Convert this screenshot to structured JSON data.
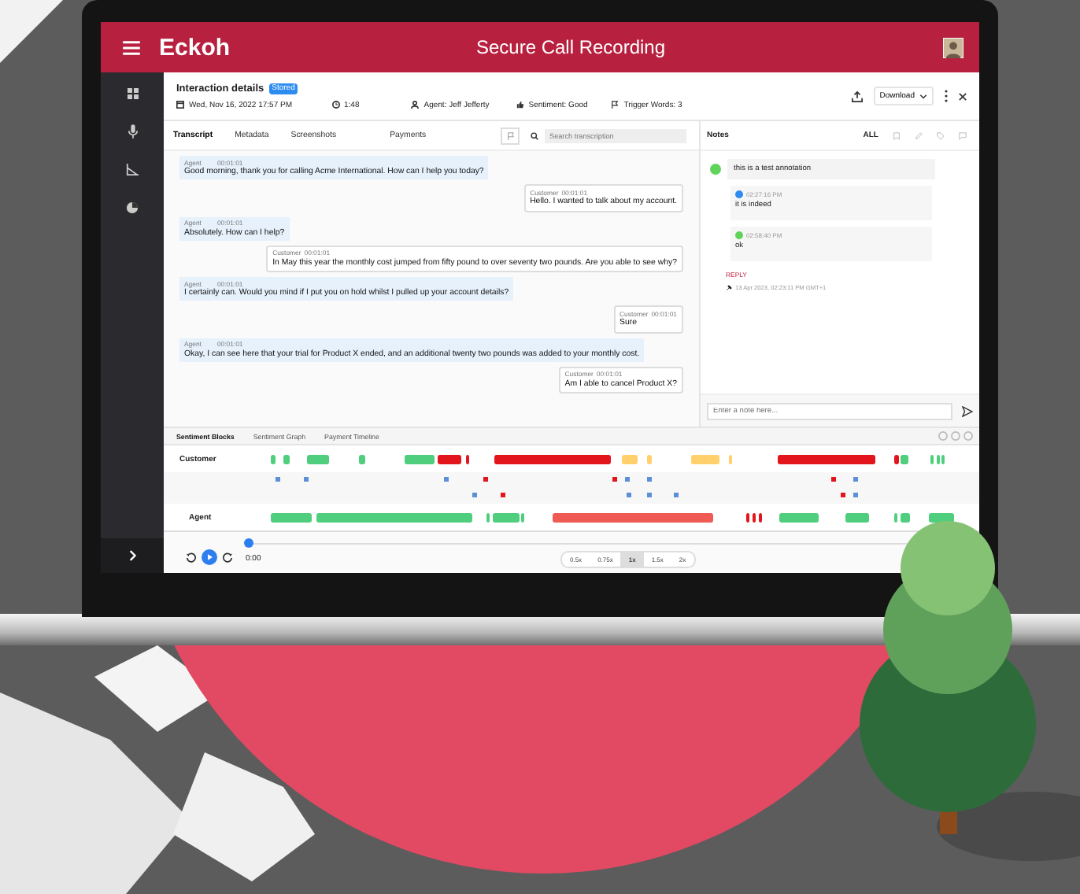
{
  "topbar": {
    "logo": "Eckoh",
    "title": "Secure Call Recording"
  },
  "interaction": {
    "title": "Interaction details",
    "badge": "Stored",
    "date": "Wed, Nov 16, 2022  17:57 PM",
    "duration": "1:48",
    "agent": "Agent: Jeff Jefferty",
    "sentiment": "Sentiment: Good",
    "trigger_words": "Trigger Words: 3",
    "download": "Download"
  },
  "tabs": [
    {
      "label": "Transcript",
      "selected": true
    },
    {
      "label": "Metadata",
      "selected": false
    },
    {
      "label": "Screenshots",
      "selected": false
    },
    {
      "label": "Payments",
      "selected": false
    }
  ],
  "search": {
    "placeholder": "Search transcription"
  },
  "messages": [
    {
      "kind": "agent",
      "speaker": "Agent",
      "time": "00:01:01",
      "text": "Good morning, thank you for calling Acme International. How can I help you today?"
    },
    {
      "kind": "customer",
      "speaker": "Customer",
      "time": "00:01:01",
      "text": "Hello. I wanted to talk about my account."
    },
    {
      "kind": "agent",
      "speaker": "Agent",
      "time": "00:01:01",
      "text": "Absolutely. How can I help?"
    },
    {
      "kind": "customer",
      "speaker": "Customer",
      "time": "00:01:01",
      "text": "In May this year the monthly cost jumped from fifty pound to over seventy two pounds. Are you able to see why?"
    },
    {
      "kind": "agent",
      "speaker": "Agent",
      "time": "00:01:01",
      "text": "I certainly can. Would you mind if I put you on hold whilst I pulled up your account details?"
    },
    {
      "kind": "customer",
      "speaker": "Customer",
      "time": "00:01:01",
      "text": "Sure"
    },
    {
      "kind": "agent",
      "speaker": "Agent",
      "time": "00:01:01",
      "text": "Okay, I can see here that your trial for Product X ended, and an additional twenty two pounds was added to your monthly cost."
    },
    {
      "kind": "customer",
      "speaker": "Customer",
      "time": "00:01:01",
      "text": "Am I able to cancel Product X?"
    }
  ],
  "notes": {
    "title": "Notes",
    "filter": "ALL",
    "note": {
      "color": "#5fd35a",
      "text": "this is a test annotation"
    },
    "replies": [
      {
        "color": "#2d8cf0",
        "time": "02:27:16 PM",
        "text": "it is indeed"
      },
      {
        "color": "#5fd35a",
        "time": "02:58:40 PM",
        "text": "ok"
      }
    ],
    "reply_label": "REPLY",
    "timestamp": "13 Apr 2023, 02:23:11 PM GMT+1",
    "input": {
      "placeholder": "Enter a note here..."
    }
  },
  "bottom_tabs": [
    {
      "label": "Sentiment Blocks",
      "selected": true
    },
    {
      "label": "Sentiment Graph",
      "selected": false
    },
    {
      "label": "Payment Timeline",
      "selected": false
    }
  ],
  "tracks": [
    {
      "label": "Customer"
    },
    {
      "label": "Agent"
    }
  ],
  "player": {
    "level": 0,
    "time": "0:00",
    "speeds": [
      {
        "label": "0.5x",
        "selected": false
      },
      {
        "label": "0.75x",
        "selected": false
      },
      {
        "label": "1x",
        "selected": true
      },
      {
        "label": "1.5x",
        "selected": false
      },
      {
        "label": "2x",
        "selected": false
      }
    ]
  }
}
